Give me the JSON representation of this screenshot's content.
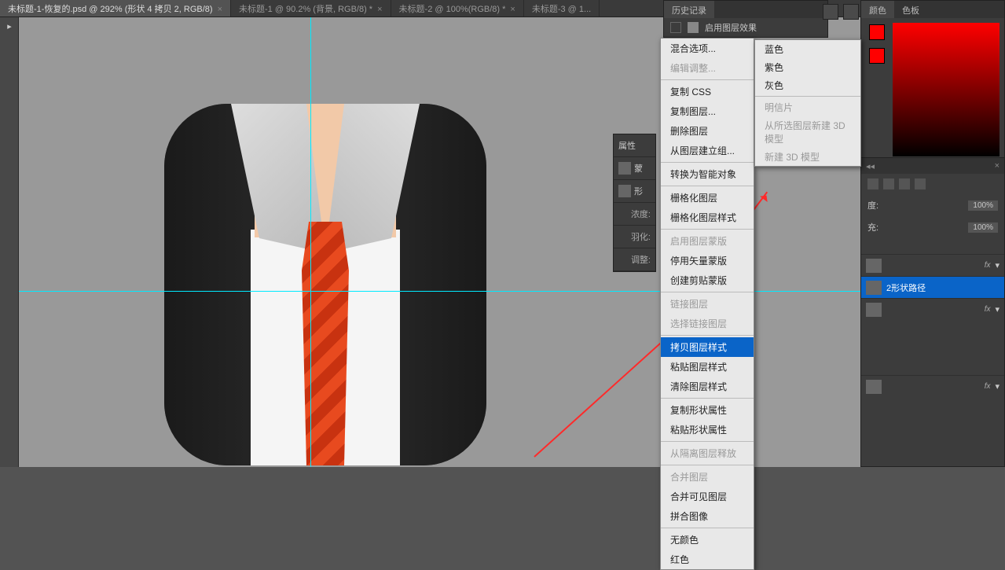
{
  "tabs": [
    {
      "label": "未标题-1-恢复的.psd @ 292% (形状 4 拷贝 2, RGB/8)",
      "active": true
    },
    {
      "label": "未标题-1 @ 90.2% (背景, RGB/8) *"
    },
    {
      "label": "未标题-2 @ 100%(RGB/8) *"
    },
    {
      "label": "未标题-3 @ 1..."
    }
  ],
  "history": {
    "title": "历史记录",
    "row": "启用图层效果"
  },
  "context_menu": [
    {
      "label": "混合选项...",
      "type": "item"
    },
    {
      "label": "编辑调整...",
      "type": "disabled"
    },
    {
      "type": "sep"
    },
    {
      "label": "复制 CSS",
      "type": "item"
    },
    {
      "label": "复制图层...",
      "type": "item"
    },
    {
      "label": "删除图层",
      "type": "item"
    },
    {
      "label": "从图层建立组...",
      "type": "item"
    },
    {
      "type": "sep"
    },
    {
      "label": "转换为智能对象",
      "type": "item"
    },
    {
      "type": "sep"
    },
    {
      "label": "栅格化图层",
      "type": "item"
    },
    {
      "label": "栅格化图层样式",
      "type": "item"
    },
    {
      "type": "sep"
    },
    {
      "label": "启用图层蒙版",
      "type": "disabled"
    },
    {
      "label": "停用矢量蒙版",
      "type": "item"
    },
    {
      "label": "创建剪贴蒙版",
      "type": "item"
    },
    {
      "type": "sep"
    },
    {
      "label": "链接图层",
      "type": "disabled"
    },
    {
      "label": "选择链接图层",
      "type": "disabled"
    },
    {
      "type": "sep"
    },
    {
      "label": "拷贝图层样式",
      "type": "sel"
    },
    {
      "label": "粘贴图层样式",
      "type": "item"
    },
    {
      "label": "清除图层样式",
      "type": "item"
    },
    {
      "type": "sep"
    },
    {
      "label": "复制形状属性",
      "type": "item"
    },
    {
      "label": "粘贴形状属性",
      "type": "item"
    },
    {
      "type": "sep"
    },
    {
      "label": "从隔离图层释放",
      "type": "disabled"
    },
    {
      "type": "sep"
    },
    {
      "label": "合并图层",
      "type": "disabled"
    },
    {
      "label": "合并可见图层",
      "type": "item"
    },
    {
      "label": "拼合图像",
      "type": "item"
    },
    {
      "type": "sep"
    },
    {
      "label": "无颜色",
      "type": "item"
    },
    {
      "label": "红色",
      "type": "item"
    }
  ],
  "submenu": [
    {
      "label": "蓝色",
      "type": "item"
    },
    {
      "label": "紫色",
      "type": "item"
    },
    {
      "label": "灰色",
      "type": "item"
    },
    {
      "type": "sep"
    },
    {
      "label": "明信片",
      "type": "disabled"
    },
    {
      "label": "从所选图层新建 3D 模型",
      "type": "disabled"
    },
    {
      "label": "新建 3D 模型",
      "type": "disabled"
    }
  ],
  "props": {
    "title": "属性",
    "mask": "蒙",
    "shape": "形",
    "density": "浓度:",
    "feather": "羽化:",
    "adjust": "调整:"
  },
  "color": {
    "tab1": "颜色",
    "tab2": "色板"
  },
  "right": {
    "opacity_lbl": "度:",
    "opacity_val": "100%",
    "fill_lbl": "充:",
    "fill_val": "100%",
    "layer_name": "2形状路径",
    "fx": "fx"
  }
}
